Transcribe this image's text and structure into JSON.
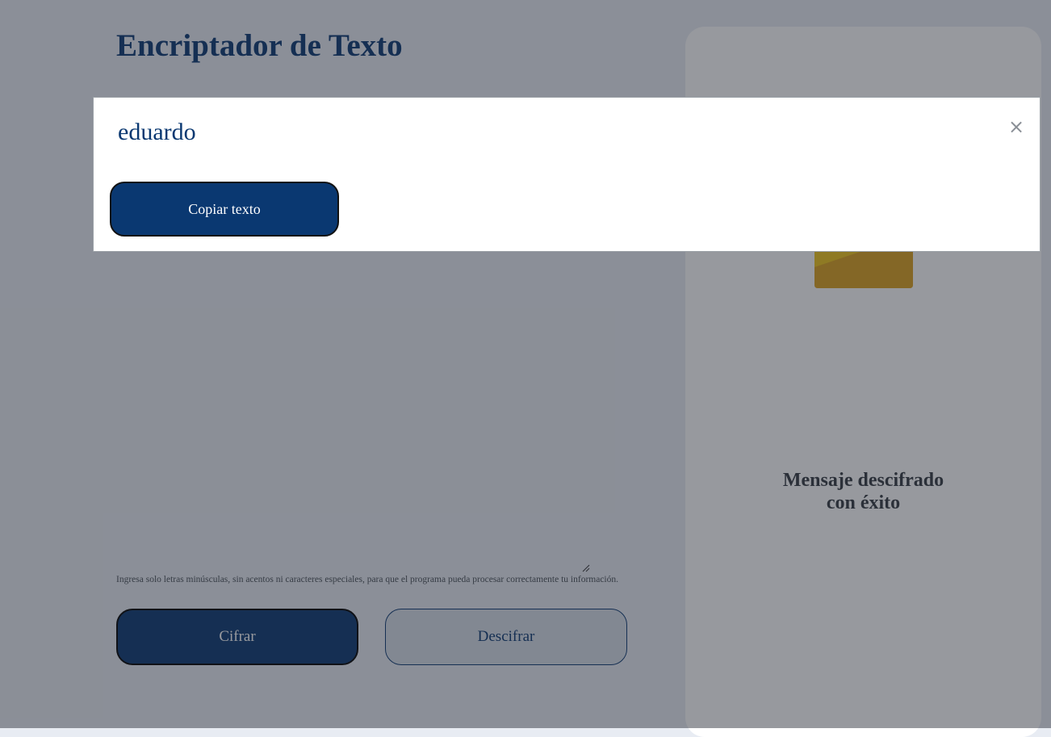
{
  "app": {
    "title": "Encriptador de Texto",
    "input_value": "",
    "hint": "Ingresa solo letras minúsculas, sin acentos ni caracteres especiales, para que el programa pueda procesar correctamente tu información.",
    "buttons": {
      "encrypt": "Cifrar",
      "decrypt": "Descifrar"
    }
  },
  "side_panel": {
    "message_line1": "Mensaje descifrado",
    "message_line2": "con éxito",
    "icon": "padlock-icon"
  },
  "modal": {
    "result_text": "eduardo",
    "copy_button": "Copiar texto",
    "close_symbol": "×"
  },
  "colors": {
    "primary": "#0a3871",
    "overlay": "rgba(35,38,48,0.47)",
    "padlock_gold": "#f0c419"
  }
}
